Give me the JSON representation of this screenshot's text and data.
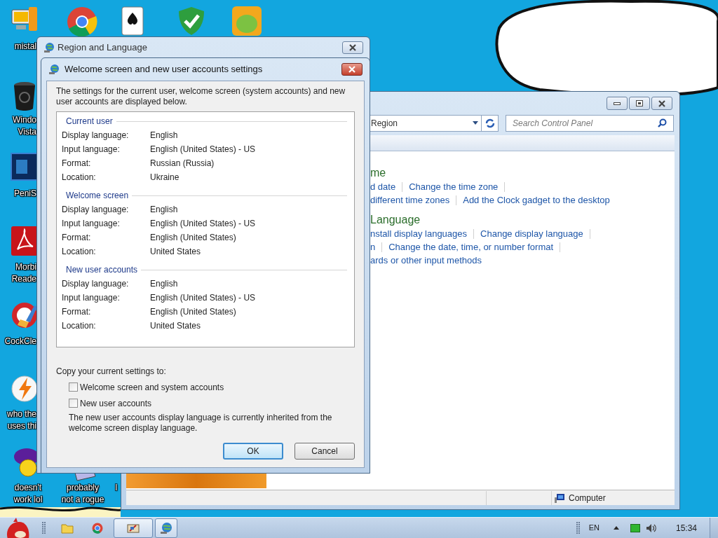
{
  "desktop_icons": [
    {
      "label": "mistal"
    },
    {
      "label": "Windo\nVista"
    },
    {
      "label": "PeniS"
    },
    {
      "label": "Morbi\nReade"
    },
    {
      "label": "CockCle"
    },
    {
      "label": "who the\nuses thi"
    },
    {
      "label": "doesn't\nwork lol"
    },
    {
      "label": "probably\nnot a rogue"
    },
    {
      "label": "I"
    }
  ],
  "control_panel": {
    "address": "Region",
    "search_placeholder": "Search Control Panel",
    "sections": [
      {
        "heading": "me",
        "rows": [
          {
            "links": [
              "d date",
              "Change the time zone"
            ],
            "trailing_separator": true
          },
          {
            "links": [
              "different time zones",
              "Add the Clock gadget to the desktop"
            ],
            "trailing_separator": false
          }
        ]
      },
      {
        "heading": "Language",
        "rows": [
          {
            "links": [
              "nstall display languages",
              "Change display language"
            ],
            "trailing_separator": true
          },
          {
            "links": [
              "n",
              "Change the date, time, or number format"
            ],
            "trailing_separator": true
          },
          {
            "links": [
              "ards or other input methods"
            ],
            "trailing_separator": false
          }
        ]
      }
    ],
    "status": "Computer"
  },
  "region_window": {
    "title": "Region and Language"
  },
  "dialog": {
    "title": "Welcome screen and new user accounts settings",
    "intro": "The settings for the current user, welcome screen (system accounts) and new user accounts are displayed below.",
    "groups": [
      {
        "title": "Current user",
        "rows": [
          {
            "label": "Display language:",
            "value": "English"
          },
          {
            "label": "Input language:",
            "value": "English (United States) - US"
          },
          {
            "label": "Format:",
            "value": "Russian (Russia)"
          },
          {
            "label": "Location:",
            "value": "Ukraine"
          }
        ]
      },
      {
        "title": "Welcome screen",
        "rows": [
          {
            "label": "Display language:",
            "value": "English"
          },
          {
            "label": "Input language:",
            "value": "English (United States) - US"
          },
          {
            "label": "Format:",
            "value": "English (United States)"
          },
          {
            "label": "Location:",
            "value": "United States"
          }
        ]
      },
      {
        "title": "New user accounts",
        "rows": [
          {
            "label": "Display language:",
            "value": "English"
          },
          {
            "label": "Input language:",
            "value": "English (United States) - US"
          },
          {
            "label": "Format:",
            "value": "English (United States)"
          },
          {
            "label": "Location:",
            "value": "United States"
          }
        ]
      }
    ],
    "copy_label": "Copy your current settings to:",
    "checkboxes": [
      {
        "label": "Welcome screen and system accounts",
        "checked": false
      },
      {
        "label": "New user accounts",
        "checked": false
      }
    ],
    "note": "The new user accounts display language is currently inherited from the welcome screen display language.",
    "buttons": [
      {
        "label": "OK",
        "default": true
      },
      {
        "label": "Cancel",
        "default": false
      }
    ]
  },
  "taskbar": {
    "buttons": [
      {
        "selected": false
      },
      {
        "selected": false
      },
      {
        "selected": true
      },
      {
        "selected": true
      }
    ],
    "language": "EN",
    "clock": "15:34"
  }
}
